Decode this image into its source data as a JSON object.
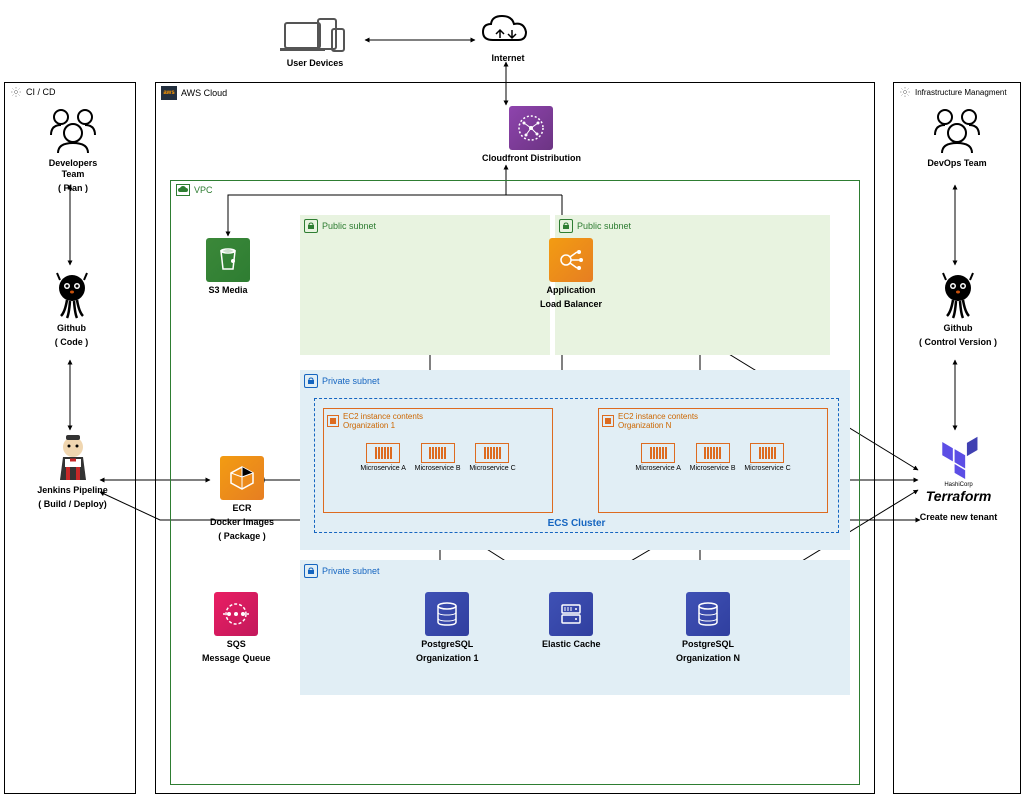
{
  "top": {
    "user_devices": "User Devices",
    "internet": "Internet"
  },
  "cicd": {
    "title": "CI / CD",
    "dev_team": "Developers Team",
    "dev_team_sub": "( Plan )",
    "github": "Github",
    "github_sub": "( Code )",
    "jenkins": "Jenkins Pipeline",
    "jenkins_sub": "( Build / Deploy)"
  },
  "infra": {
    "title": "Infrastructure Managment",
    "devops_team": "DevOps Team",
    "github": "Github",
    "github_sub": "( Control Version )",
    "terraform_brand": "HashiCorp",
    "terraform": "Terraform",
    "terraform_sub": "Create new tenant"
  },
  "aws": {
    "title": "AWS Cloud",
    "vpc": "VPC",
    "cloudfront": "Cloudfront Distribution",
    "public_subnet": "Public subnet",
    "private_subnet": "Private subnet",
    "s3": "S3 Media",
    "alb_1": "Application",
    "alb_2": "Load Balancer",
    "ecr_1": "ECR",
    "ecr_2": "Docker Images",
    "ecr_3": "( Package )",
    "sqs_1": "SQS",
    "sqs_2": "Message Queue",
    "ecs_cluster": "ECS Cluster",
    "ec2_1_title_1": "EC2 instance contents",
    "ec2_1_title_2": "Organization 1",
    "ec2_n_title_1": "EC2 instance contents",
    "ec2_n_title_2": "Organization N",
    "microservice_a": "Microservice A",
    "microservice_b": "Microservice B",
    "microservice_c": "Microservice C",
    "postgres_1": "PostgreSQL",
    "postgres_1_sub": "Organization 1",
    "postgres_n": "PostgreSQL",
    "postgres_n_sub": "Organization N",
    "elastic_cache": "Elastic Cache"
  }
}
